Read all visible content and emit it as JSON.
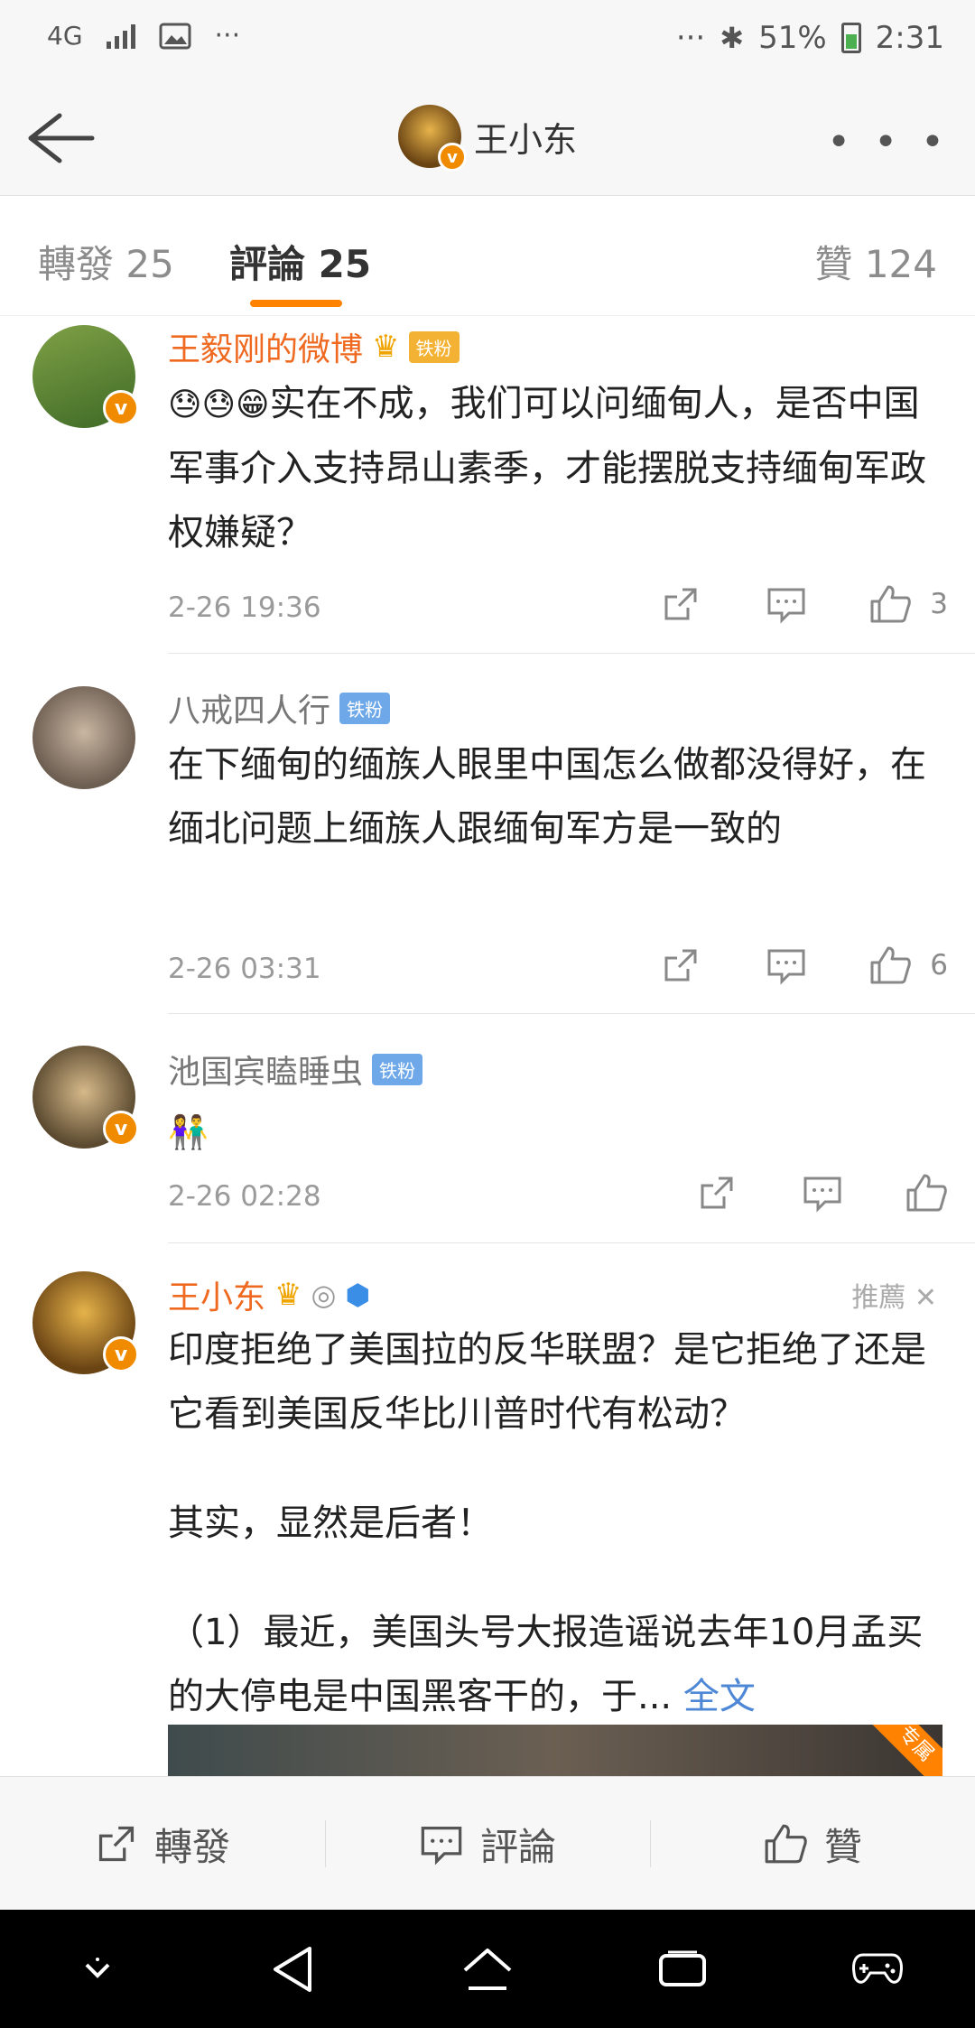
{
  "status_bar": {
    "network": "4G",
    "left_more": "···",
    "right_more": "···",
    "battery": "51%",
    "time": "2:31"
  },
  "nav": {
    "title": "王小东",
    "more": "• • •"
  },
  "tabs": {
    "repost": "轉發 25",
    "comment": "評論 25",
    "like": "贊 124"
  },
  "comments": [
    {
      "name": "王毅刚的微博",
      "level": "6",
      "badge": "铁粉",
      "emoji": "😓😓😁",
      "text": "实在不成，我们可以问缅甸人，是否中国军事介入支持昂山素季，才能摆脱支持缅甸军政权嫌疑？",
      "time": "2-26 19:36",
      "likes": "3"
    },
    {
      "name": "八戒四人行",
      "badge": "铁粉",
      "text": "在下缅甸的缅族人眼里中国怎么做都没得好，在缅北问题上缅族人跟缅甸军方是一致的",
      "time": "2-26 03:31",
      "likes": "6"
    },
    {
      "name": "池国宾瞌睡虫",
      "badge": "铁粉",
      "emoji": "👫",
      "time": "2-26 02:28",
      "likes": ""
    },
    {
      "name": "王小东",
      "recommend": "推薦",
      "text_p1": "印度拒绝了美国拉的反华联盟？是它拒绝了还是它看到美国反华比川普时代有松动？",
      "text_p2": "其实，显然是后者！",
      "text_p3": "（1）最近，美国头号大报造谣说去年10月孟买的大停电是中国黑客干的，于...",
      "more": "全文",
      "corner": "专属"
    }
  ],
  "bottom_bar": {
    "repost": "轉發",
    "comment": "評論",
    "like": "贊"
  }
}
